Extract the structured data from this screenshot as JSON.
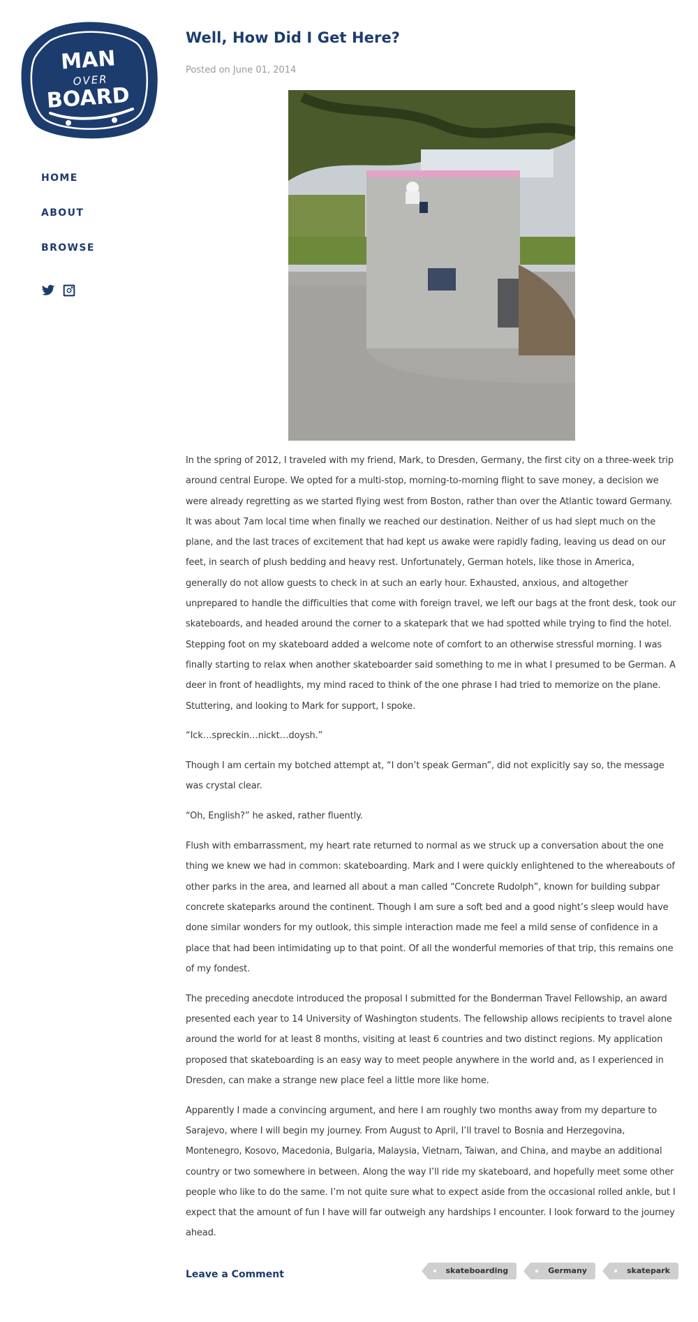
{
  "logo": {
    "line1": "MAN",
    "line2": "OVER",
    "line3": "BOARD"
  },
  "nav": {
    "items": [
      {
        "label": "HOME"
      },
      {
        "label": "ABOUT"
      },
      {
        "label": "BROWSE"
      }
    ]
  },
  "social": {
    "icons": [
      "twitter-icon",
      "instagram-icon"
    ]
  },
  "post": {
    "title": "Well, How Did I Get Here?",
    "posted": "Posted on June 01, 2014",
    "paragraphs": [
      "In the spring of 2012, I traveled with my friend, Mark, to Dresden, Germany, the first city on a three-week trip around central Europe. We opted for a multi-stop, morning-to-morning flight to save money, a decision we were already regretting as we started flying west from Boston, rather than over the Atlantic toward Germany. It was about 7am local time when finally we reached our destination. Neither of us had slept much on the plane, and the last traces of excitement that had kept us awake were rapidly fading, leaving us dead on our feet, in search of plush bedding and heavy rest. Unfortunately, German hotels, like those in America, generally do not allow guests to check in at such an early hour. Exhausted, anxious, and altogether unprepared to handle the difficulties that come with foreign travel, we left our bags at the front desk, took our skateboards, and headed around the corner to a skatepark that we had spotted while trying to find the hotel. Stepping foot on my skateboard added a welcome note of comfort to an otherwise stressful morning. I was finally starting to relax when another skateboarder said something to me in what I presumed to be German. A deer in front of headlights, my mind raced to think of the one phrase I had tried to memorize on the plane. Stuttering, and looking to Mark for support, I spoke.",
      "“Ick…spreckin…nickt…doysh.”",
      "Though I am certain my botched attempt at, “I don’t speak German”, did not explicitly say so, the message was crystal clear.",
      "“Oh, English?” he asked, rather fluently.",
      "Flush with embarrassment, my heart rate returned to normal as we struck up a conversation about the one thing we knew we had in common: skateboarding. Mark and I were quickly enlightened to the whereabouts of other parks in the area, and learned all about a man called “Concrete Rudolph”, known for building subpar concrete skateparks around the continent. Though I am sure a soft bed and a good night’s sleep would have done similar wonders for my outlook, this simple interaction made me feel a mild sense of confidence in a place that had been intimidating up to that point. Of all the wonderful memories of that trip, this remains one of my fondest.",
      "The preceding anecdote introduced the proposal I submitted for the Bonderman Travel Fellowship, an award presented each year to 14 University of Washington students. The fellowship allows recipients to travel alone around the world for at least 8 months, visiting at least 6 countries and two distinct regions. My application proposed that skateboarding is an easy way to meet people anywhere in the world and, as I experienced in Dresden, can make a strange new place feel a little more like home.",
      "Apparently I made a convincing argument, and here I am roughly two months away from my departure to Sarajevo, where I will begin my journey. From August to April, I’ll travel to Bosnia and Herzegovina, Montenegro, Kosovo, Macedonia, Bulgaria, Malaysia, Vietnam, Taiwan, and China, and maybe an additional country or two somewhere in between. Along the way I’ll ride my skateboard, and hopefully meet some other people who like to do the same. I’m not quite sure what to expect aside from the occasional rolled ankle, but I expect that the amount of fun I have will far outweigh any hardships I encounter. I look forward to the journey ahead."
    ],
    "comment_link": "Leave a Comment",
    "tags": [
      "skateboarding",
      "Germany",
      "skatepark"
    ]
  },
  "colors": {
    "brand": "#1d3c6e",
    "meta": "#9a9a9a",
    "tag_bg": "#cfcfcf",
    "text": "#3a3a3a"
  }
}
